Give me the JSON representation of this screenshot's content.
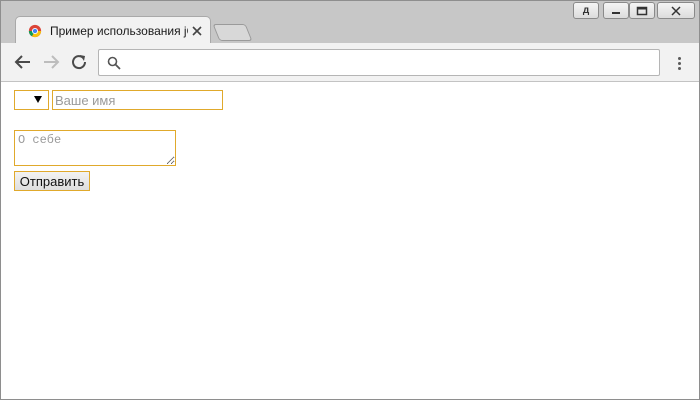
{
  "browser": {
    "tab": {
      "title": "Пример использования jQuery"
    },
    "profile_button_label": "д",
    "omnibox": {
      "value": "",
      "placeholder": ""
    }
  },
  "icons": {
    "favicon": "chrome-favicon",
    "tab_close": "close-icon",
    "back": "arrow-left-icon",
    "forward": "arrow-right-icon",
    "reload": "reload-icon",
    "search": "search-icon",
    "menu": "vertical-dots-icon",
    "minimize": "minimize-icon",
    "maximize": "maximize-icon",
    "window_close": "close-icon"
  },
  "form": {
    "select": {
      "selected": ""
    },
    "name_input": {
      "value": "",
      "placeholder": "Ваше имя"
    },
    "about_textarea": {
      "value": "",
      "placeholder": "О себе"
    },
    "submit_label": "Отправить"
  },
  "colors": {
    "accent_border": "#e0a92c",
    "tabstrip_bg": "#c7c7c7",
    "toolbar_bg": "#f2f2f2"
  }
}
